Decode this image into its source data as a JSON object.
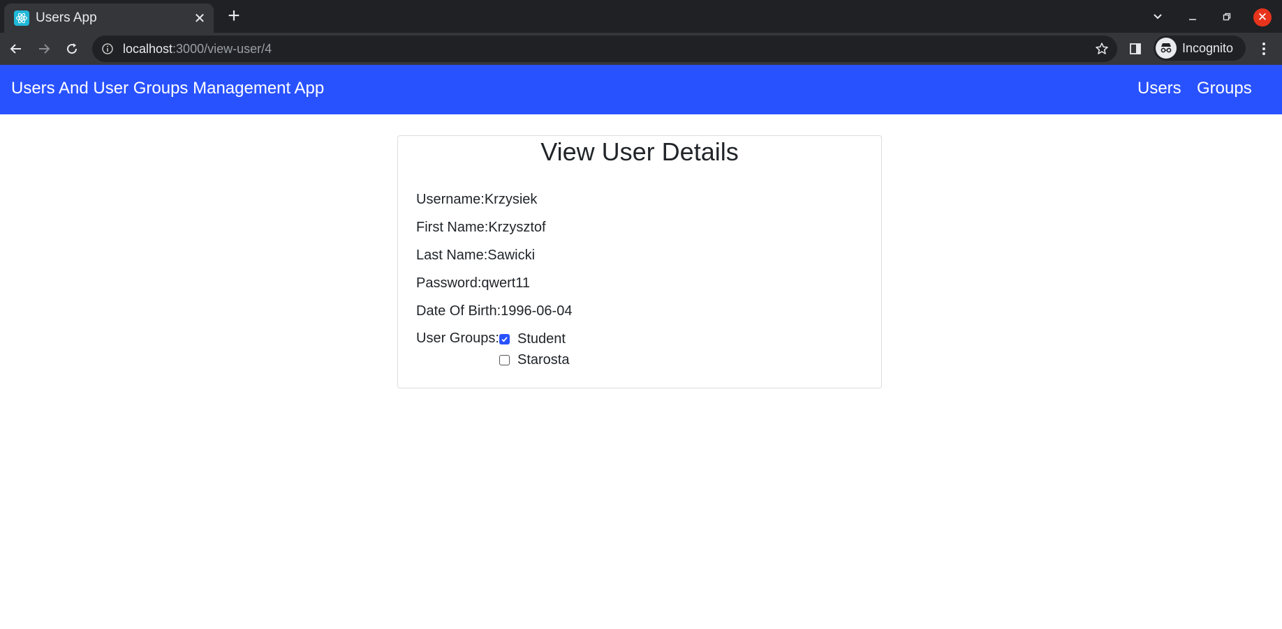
{
  "browser": {
    "tab_title": "Users App",
    "url_host": "localhost",
    "url_path": ":3000/view-user/4",
    "profile_label": "Incognito"
  },
  "navbar": {
    "brand": "Users And User Groups Management App",
    "links": [
      "Users",
      "Groups"
    ],
    "color": "#2952ff"
  },
  "card": {
    "title": "View User Details",
    "fields": [
      {
        "label": "Username:",
        "value": "Krzysiek"
      },
      {
        "label": "First Name:",
        "value": "Krzysztof"
      },
      {
        "label": "Last Name:",
        "value": "Sawicki"
      },
      {
        "label": "Password:",
        "value": "qwert11"
      },
      {
        "label": "Date Of Birth:",
        "value": "1996-06-04"
      }
    ],
    "groups_label": "User Groups:",
    "groups": [
      {
        "name": "Student",
        "checked": true
      },
      {
        "name": "Starosta",
        "checked": false
      }
    ]
  }
}
